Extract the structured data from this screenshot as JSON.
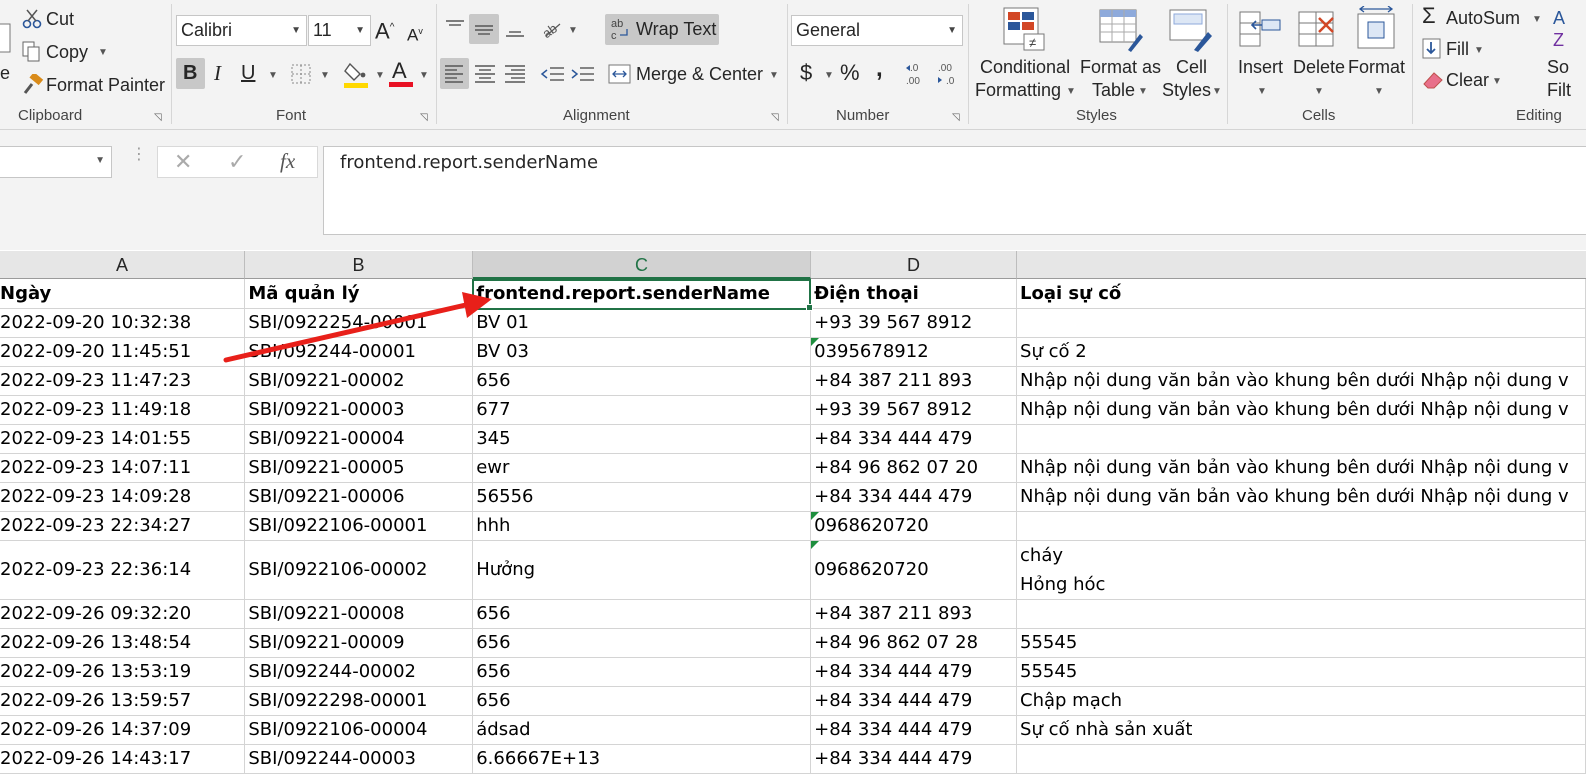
{
  "ribbon": {
    "clipboard": {
      "paste_partial": "e",
      "cut": "Cut",
      "copy": "Copy",
      "format_painter": "Format Painter",
      "group": "Clipboard"
    },
    "font": {
      "name": "Calibri",
      "size": "11",
      "group": "Font",
      "bold": "B",
      "italic": "I",
      "underline": "U"
    },
    "alignment": {
      "wrap_text": "Wrap Text",
      "merge_center": "Merge & Center",
      "group": "Alignment"
    },
    "number": {
      "format": "General",
      "currency": "$",
      "percent": "%",
      "comma": ",",
      "group": "Number"
    },
    "styles": {
      "conditional_line1": "Conditional",
      "conditional_line2": "Formatting",
      "table_line1": "Format as",
      "table_line2": "Table",
      "cell_line1": "Cell",
      "cell_line2": "Styles",
      "group": "Styles"
    },
    "cells": {
      "insert": "Insert",
      "delete": "Delete",
      "format": "Format",
      "group": "Cells"
    },
    "editing": {
      "autosum": "AutoSum",
      "fill": "Fill",
      "clear": "Clear",
      "sort_partial1": "So",
      "sort_partial2": "Filt",
      "group": "Editing"
    }
  },
  "formula_bar": {
    "name_box": "",
    "fx": "fx",
    "content": "frontend.report.senderName"
  },
  "columns": [
    "A",
    "B",
    "C",
    "D",
    ""
  ],
  "selected_column": "C",
  "header_row": [
    "Ngày",
    "Mã quản lý",
    "frontend.report.senderName",
    "Điện thoại",
    "Loại sự cố"
  ],
  "rows": [
    {
      "a": "2022-09-20 10:32:38",
      "b": "SBI/0922254-00001",
      "c": "BV 01",
      "d": "+93 39 567 8912",
      "e": ""
    },
    {
      "a": "2022-09-20 11:45:51",
      "b": "SBI/092244-00001",
      "c": "BV 03",
      "d": "0395678912",
      "e": "Sự cố 2"
    },
    {
      "a": "2022-09-23 11:47:23",
      "b": "SBI/09221-00002",
      "c": "656",
      "d": "+84 387 211 893",
      "e": "Nhập nội dung văn bản vào khung bên dưới Nhập nội dung v"
    },
    {
      "a": "2022-09-23 11:49:18",
      "b": "SBI/09221-00003",
      "c": "677",
      "d": "+93 39 567 8912",
      "e": "Nhập nội dung văn bản vào khung bên dưới Nhập nội dung v"
    },
    {
      "a": "2022-09-23 14:01:55",
      "b": "SBI/09221-00004",
      "c": "345",
      "d": "+84 334 444 479",
      "e": ""
    },
    {
      "a": "2022-09-23 14:07:11",
      "b": "SBI/09221-00005",
      "c": "ewr",
      "d": "+84 96 862 07 20",
      "e": "Nhập nội dung văn bản vào khung bên dưới Nhập nội dung v"
    },
    {
      "a": "2022-09-23 14:09:28",
      "b": "SBI/09221-00006",
      "c": "56556",
      "d": "+84 334 444 479",
      "e": "Nhập nội dung văn bản vào khung bên dưới Nhập nội dung v"
    },
    {
      "a": "2022-09-23 22:34:27",
      "b": "SBI/0922106-00001",
      "c": "hhh",
      "d": "0968620720",
      "e": ""
    },
    {
      "a": "2022-09-23 22:36:14",
      "b": "SBI/0922106-00002",
      "c": "Hưởng",
      "d": "0968620720",
      "e1": "cháy",
      "e2": "Hỏng hóc"
    },
    {
      "a": "2022-09-26 09:32:20",
      "b": "SBI/09221-00008",
      "c": "656",
      "d": "+84 387 211 893",
      "e": ""
    },
    {
      "a": "2022-09-26 13:48:54",
      "b": "SBI/09221-00009",
      "c": "656",
      "d": "+84 96 862 07 28",
      "e": "55545"
    },
    {
      "a": "2022-09-26 13:53:19",
      "b": "SBI/092244-00002",
      "c": "656",
      "d": "+84 334 444 479",
      "e": "55545"
    },
    {
      "a": "2022-09-26 13:59:57",
      "b": "SBI/0922298-00001",
      "c": "656",
      "d": "+84 334 444 479",
      "e": "Chập mạch"
    },
    {
      "a": "2022-09-26 14:37:09",
      "b": "SBI/0922106-00004",
      "c": "ádsad",
      "d": "+84 334 444 479",
      "e": "Sự cố nhà sản xuất"
    },
    {
      "a": "2022-09-26 14:43:17",
      "b": "SBI/092244-00003",
      "c": "6.66667E+13",
      "d": "+84 334 444 479",
      "e": ""
    }
  ],
  "colors": {
    "excel_green": "#217346",
    "annotation_arrow": "#e8201a",
    "font_color_bar": "#e81123",
    "highlight_bar": "#ffd800"
  }
}
